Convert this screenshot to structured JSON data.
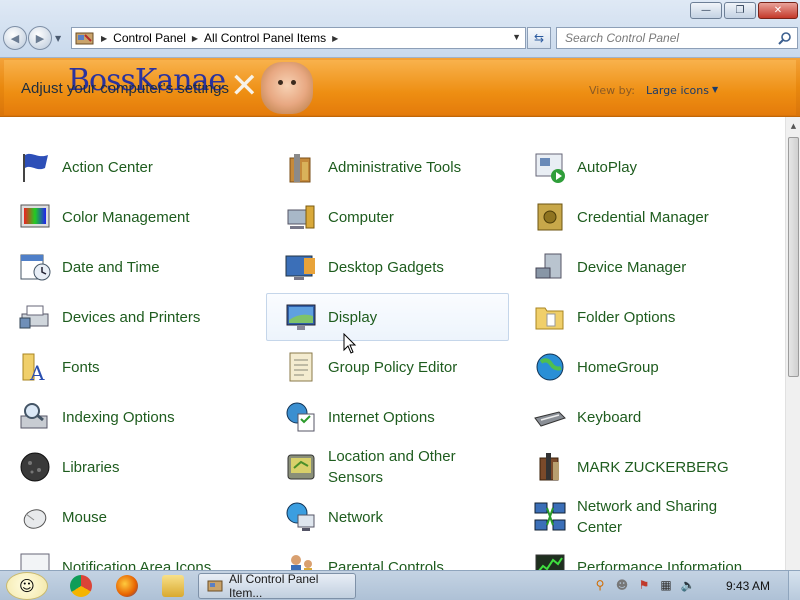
{
  "window": {
    "minimize_glyph": "—",
    "maximize_glyph": "❐",
    "close_glyph": "✕"
  },
  "address": {
    "crumbs": [
      "Control Panel",
      "All Control Panel Items"
    ],
    "search_placeholder": "Search Control Panel"
  },
  "banner": {
    "title": "Adjust your computer's settings",
    "logo_text": "BossKanae",
    "view_by_label": "View by:",
    "view_by_value": "Large icons"
  },
  "items": [
    {
      "label": "Action Center",
      "icon": "flag-icon"
    },
    {
      "label": "Administrative Tools",
      "icon": "admin-tools-icon"
    },
    {
      "label": "AutoPlay",
      "icon": "autoplay-icon"
    },
    {
      "label": "Color Management",
      "icon": "color-management-icon"
    },
    {
      "label": "Computer",
      "icon": "computer-icon"
    },
    {
      "label": "Credential Manager",
      "icon": "vault-icon"
    },
    {
      "label": "Date and Time",
      "icon": "calendar-clock-icon"
    },
    {
      "label": "Desktop Gadgets",
      "icon": "gadgets-icon"
    },
    {
      "label": "Device Manager",
      "icon": "device-manager-icon"
    },
    {
      "label": "Devices and Printers",
      "icon": "printer-icon"
    },
    {
      "label": "Display",
      "icon": "monitor-icon"
    },
    {
      "label": "Folder Options",
      "icon": "folder-icon"
    },
    {
      "label": "Fonts",
      "icon": "fonts-folder-icon"
    },
    {
      "label": "Group Policy Editor",
      "icon": "policy-icon"
    },
    {
      "label": "HomeGroup",
      "icon": "globe-icon"
    },
    {
      "label": "Indexing Options",
      "icon": "indexing-icon"
    },
    {
      "label": "Internet Options",
      "icon": "internet-options-icon"
    },
    {
      "label": "Keyboard",
      "icon": "keyboard-icon"
    },
    {
      "label": "Libraries",
      "icon": "libraries-icon"
    },
    {
      "label": "Location and Other Sensors",
      "icon": "gps-icon"
    },
    {
      "label": "MARK ZUCKERBERG",
      "icon": "user-tools-icon"
    },
    {
      "label": "Mouse",
      "icon": "mouse-icon"
    },
    {
      "label": "Network",
      "icon": "network-globe-icon"
    },
    {
      "label": "Network and Sharing Center",
      "icon": "network-sharing-icon"
    },
    {
      "label": "Notification Area Icons",
      "icon": "notification-icon"
    },
    {
      "label": "Parental Controls",
      "icon": "parental-icon"
    },
    {
      "label": "Performance Information",
      "icon": "performance-icon"
    }
  ],
  "taskbar": {
    "task_label": "All Control Panel Item...",
    "clock": "9:43 AM"
  },
  "colors": {
    "banner_orange": "#ee8e12",
    "item_text": "#1e5c1e",
    "taskbar": "#b8c9dc"
  }
}
